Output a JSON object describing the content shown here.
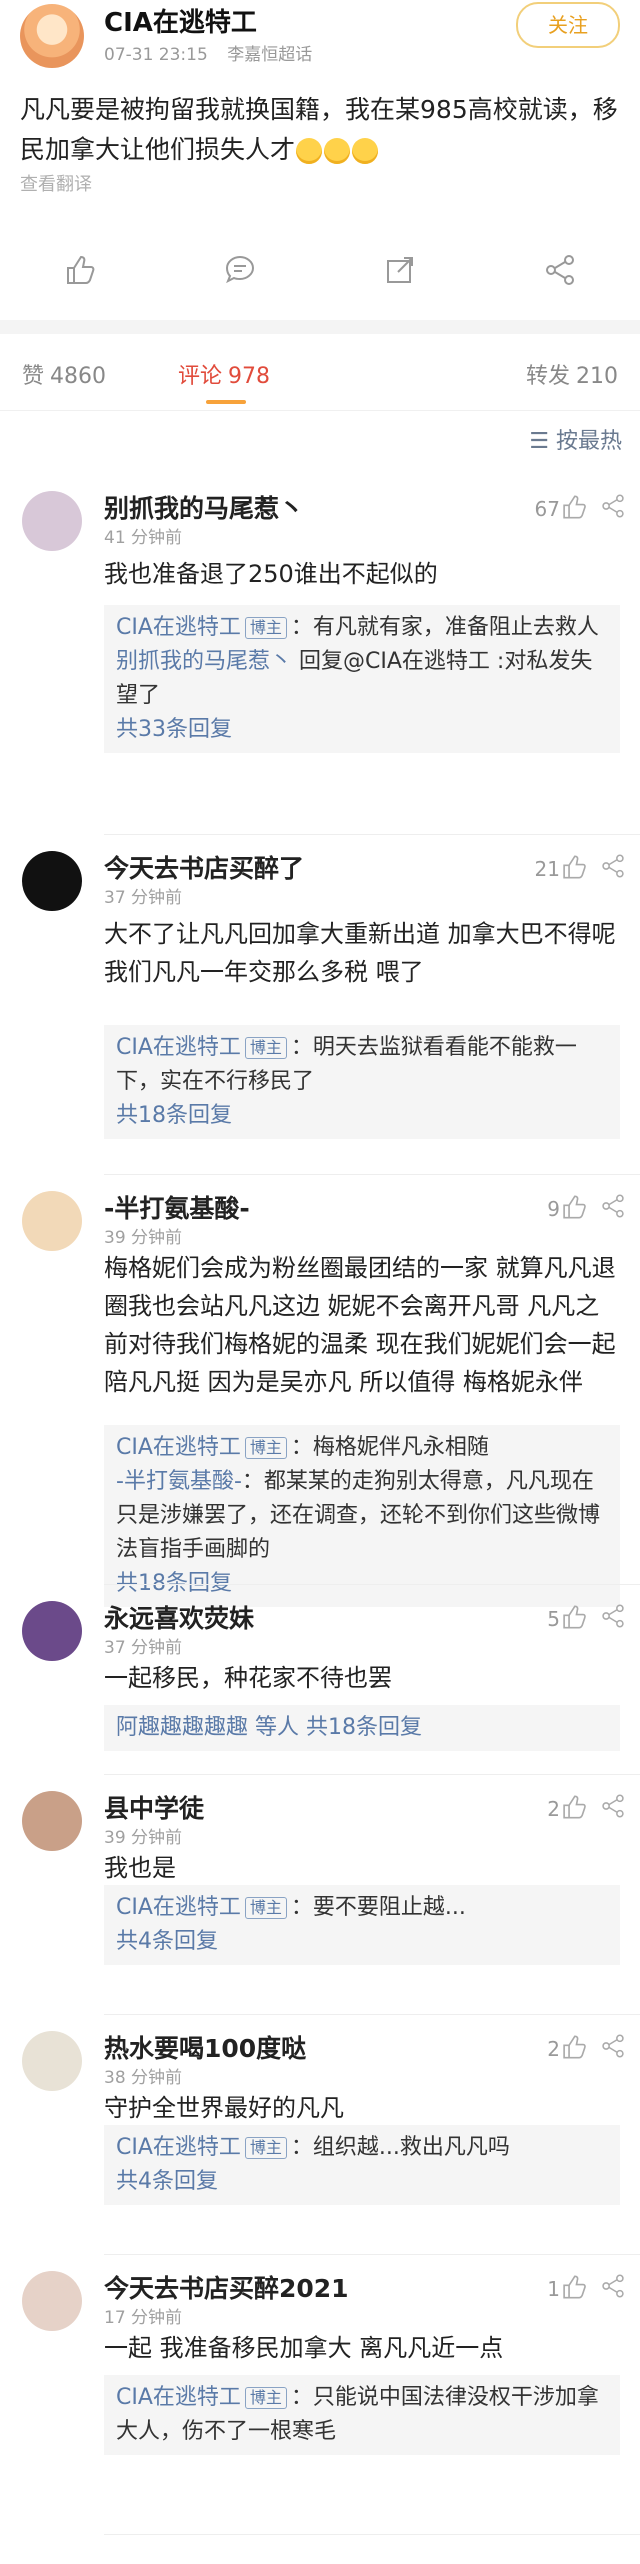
{
  "post": {
    "author": "CIA在逃特工",
    "date": "07-31 23:15",
    "badge": "李嘉恒超话",
    "follow_label": "关注",
    "text": "凡凡要是被拘留我就换国籍，我在某985高校就读，移民加拿大让他们损失人才",
    "translate_label": "查看翻译",
    "emoji_count": 3
  },
  "actions": [
    "share-icon",
    "comment-icon",
    "repost-icon",
    "like-icon",
    "more-icon"
  ],
  "stats": {
    "likes_label": "赞",
    "likes": "4860",
    "comments_label": "评论",
    "comments": "978",
    "reposts_label": "转发",
    "reposts": "210"
  },
  "sort_label": "按最热",
  "comments": [
    {
      "name": "别抓我的马尾惹丶",
      "time": "41 分钟前",
      "likes": "67",
      "text": "我也准备退了250谁出不起似的",
      "replies": [
        {
          "name": "CIA在逃特工",
          "tag": "博主",
          "text": "：有凡就有家，准备阻止去救人"
        },
        {
          "name": "别抓我的马尾惹丶",
          "text": " 回复@CIA在逃特工 :对私发失望了"
        }
      ],
      "more": "共33条回复",
      "avatar_color": "#d8c8d8"
    },
    {
      "name": "今天去书店买醉了",
      "time": "37 分钟前",
      "likes": "21",
      "text": "大不了让凡凡回加拿大重新出道 加拿大巴不得呢 我们凡凡一年交那么多税 喂了",
      "replies": [
        {
          "name": "CIA在逃特工",
          "tag": "博主",
          "text": "：明天去监狱看看能不能救一下，实在不行移民了"
        }
      ],
      "more": "共18条回复",
      "avatar_color": "#111111"
    },
    {
      "name": "-半打氨基酸-",
      "time": "39 分钟前",
      "likes": "9",
      "text": "梅格妮们会成为粉丝圈最团结的一家 就算凡凡退圈我也会站凡凡这边 妮妮不会离开凡哥 凡凡之前对待我们梅格妮的温柔 现在我们妮妮们会一起陪凡凡挺 因为是吴亦凡 所以值得 梅格妮永伴",
      "replies": [
        {
          "name": "CIA在逃特工",
          "tag": "博主",
          "text": "：梅格妮伴凡永相随"
        },
        {
          "name": "-半打氨基酸-",
          "text": "：都某某的走狗别太得意，凡凡现在只是涉嫌罢了，还在调查，还轮不到你们这些微博法盲指手画脚的"
        }
      ],
      "more": "共18条回复",
      "avatar_color": "#f2d9b8"
    },
    {
      "name": "永远喜欢荧妹",
      "time": "37 分钟前",
      "likes": "5",
      "text": "一起移民，种花家不待也罢",
      "replies": [],
      "more_name": "阿趣趣趣趣趣",
      "more": "等人 共18条回复",
      "avatar_color": "#6b4a8a"
    },
    {
      "name": "县中学徒",
      "time": "39 分钟前",
      "likes": "2",
      "text": "我也是",
      "replies": [
        {
          "name": "CIA在逃特工",
          "tag": "博主",
          "text": "：要不要阻止越..."
        }
      ],
      "more": "共4条回复",
      "avatar_color": "#c9a088"
    },
    {
      "name": "热水要喝100度哒",
      "time": "38 分钟前",
      "likes": "2",
      "text": "守护全世界最好的凡凡",
      "replies": [
        {
          "name": "CIA在逃特工",
          "tag": "博主",
          "text": "：组织越...救出凡凡吗"
        }
      ],
      "more": "共4条回复",
      "avatar_color": "#e8e2d6"
    },
    {
      "name": "今天去书店买醉2021",
      "time": "17 分钟前",
      "likes": "1",
      "text": "一起 我准备移民加拿大 离凡凡近一点",
      "replies": [
        {
          "name": "CIA在逃特工",
          "tag": "博主",
          "text": "：只能说中国法律没权干涉加拿大人，伤不了一根寒毛"
        }
      ],
      "more": "",
      "avatar_color": "#e6d2c8"
    }
  ]
}
